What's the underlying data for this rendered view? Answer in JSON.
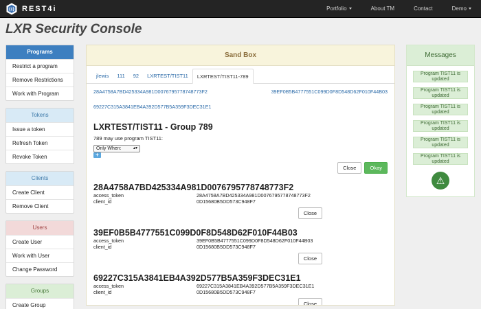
{
  "nav": {
    "brand": "REST4i",
    "items": [
      "Portfolio",
      "About TM",
      "Contact",
      "Demo"
    ]
  },
  "page_title": "LXR Security Console",
  "sidebar": {
    "programs": {
      "title": "Programs",
      "items": [
        "Restrict a program",
        "Remove Restrictions",
        "Work with Program"
      ]
    },
    "tokens": {
      "title": "Tokens",
      "items": [
        "Issue a token",
        "Refresh Token",
        "Revoke Token"
      ]
    },
    "clients": {
      "title": "Clients",
      "items": [
        "Create Client",
        "Remove Client"
      ]
    },
    "users": {
      "title": "Users",
      "items": [
        "Create User",
        "Work with User",
        "Change Password"
      ]
    },
    "groups": {
      "title": "Groups",
      "items": [
        "Create Group"
      ]
    }
  },
  "sandbox": {
    "title": "Sand Box",
    "tabs": [
      "jlewis",
      "111",
      "92",
      "LXRTEST/TIST11",
      "LXRTEST/TIST11-789"
    ],
    "links": [
      "28A4758A7BD425334A981D00767957787487 73F2",
      "39EF0B5B4777551C099D0F8D548D62F010F44B03",
      "69227C315A3841EB4A392D577B5A359F3DEC31E1"
    ],
    "main": {
      "title": "LXRTEST/TIST11 - Group 789",
      "message": "789 may use program TIST11:",
      "select_value": "Only When:",
      "plus_label": "+",
      "close_label": "Close",
      "okay_label": "Okay"
    },
    "tokens": [
      {
        "title": "28A4758A7BD425334A981D0076795778748773F2",
        "access_token_label": "access_token",
        "access_token": "28A4758A7BD425334A981D0076795778748773F2",
        "client_id_label": "client_id",
        "client_id": "0D15680B5DD573C948F7",
        "close_label": "Close"
      },
      {
        "title": "39EF0B5B4777551C099D0F8D548D62F010F44B03",
        "access_token_label": "access_token",
        "access_token": "39EF0B5B4777551C099D0F8D548D62F010F44B03",
        "client_id_label": "client_id",
        "client_id": "0D15680B5DD573C948F7",
        "close_label": "Close"
      },
      {
        "title": "69227C315A3841EB4A392D577B5A359F3DEC31E1",
        "access_token_label": "access_token",
        "access_token": "69227C315A3841EB4A392D577B5A359F3DEC31E1",
        "client_id_label": "client_id",
        "client_id": "0D15680B5DD573C948F7",
        "close_label": "Close"
      }
    ]
  },
  "messages": {
    "title": "Messages",
    "items": [
      "Program TIST11 is updated",
      "Program TIST11 is updated",
      "Program TIST11 is updated",
      "Program TIST11 is updated",
      "Program TIST11 is updated",
      "Program TIST11 is updated"
    ],
    "warning_icon": "warning-icon"
  },
  "colors": {
    "navbar": "#242424",
    "programs_header": "#3d7fc0",
    "sandbox_header": "#f8f4dc",
    "messages_header": "#dbeed6",
    "okay_button": "#5cb85c"
  }
}
